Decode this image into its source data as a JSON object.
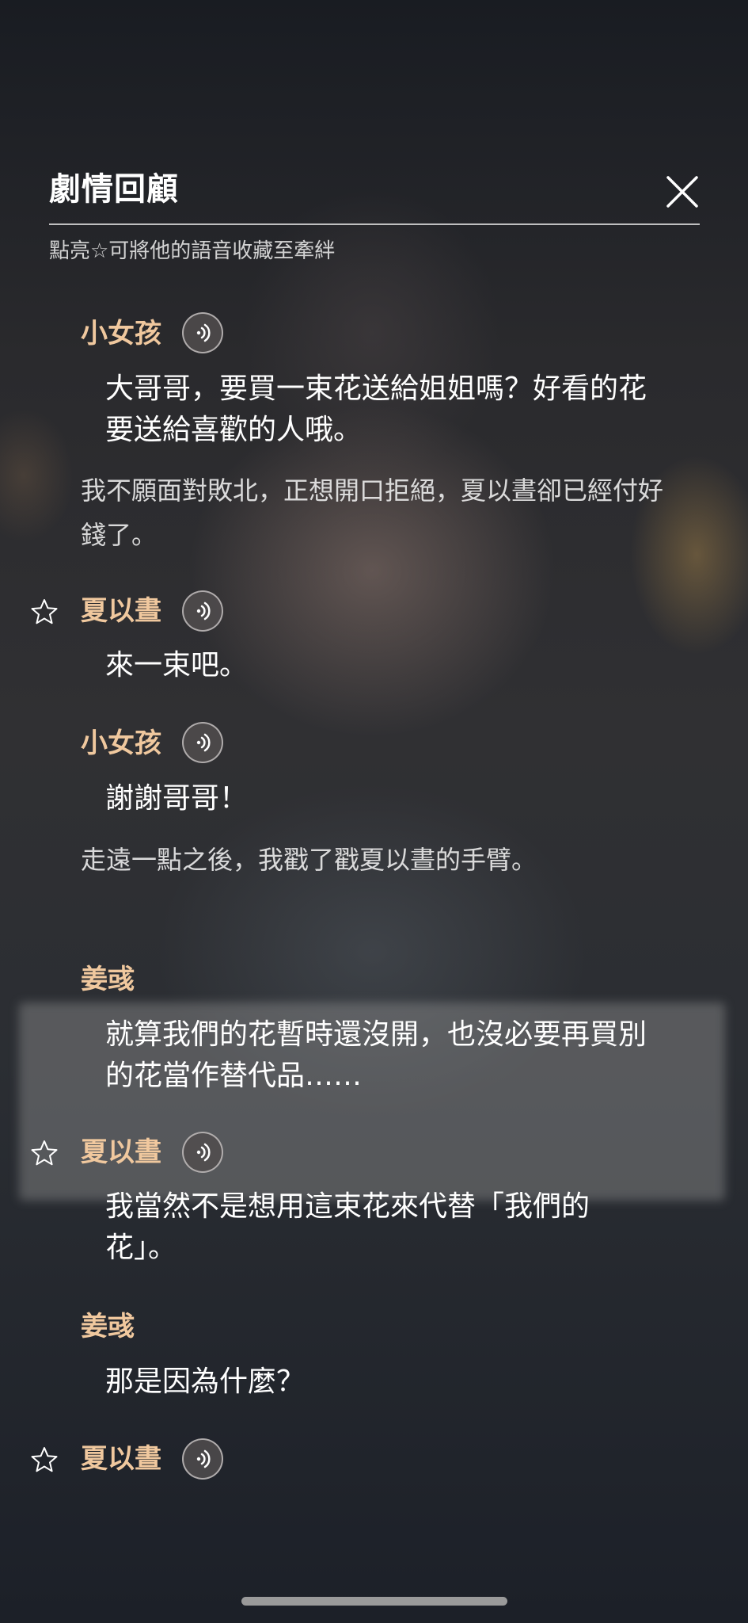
{
  "header": {
    "title": "劇情回顧",
    "subtitle": "點亮☆可將他的語音收藏至牽絆"
  },
  "dialogue": [
    {
      "speaker": "小女孩",
      "voice": true,
      "star": false,
      "line": "大哥哥，要買一束花送給姐姐嗎？好看的花要送給喜歡的人哦。"
    },
    {
      "narration": "我不願面對敗北，正想開口拒絕，夏以晝卻已經付好錢了。"
    },
    {
      "speaker": "夏以晝",
      "voice": true,
      "star": true,
      "line": "來一束吧。"
    },
    {
      "speaker": "小女孩",
      "voice": true,
      "star": false,
      "line": "謝謝哥哥！"
    },
    {
      "narration": "走遠一點之後，我戳了戳夏以晝的手臂。"
    },
    {
      "speaker": "姜彧",
      "voice": false,
      "star": false,
      "line": "就算我們的花暫時還沒開，也沒必要再買別的花當作替代品……"
    },
    {
      "speaker": "夏以晝",
      "voice": true,
      "star": true,
      "line": "我當然不是想用這束花來代替「我們的花」。"
    },
    {
      "speaker": "姜彧",
      "voice": false,
      "star": false,
      "line": "那是因為什麼？"
    },
    {
      "speaker": "夏以晝",
      "voice": true,
      "star": true,
      "line": ""
    }
  ],
  "icons": {
    "close": "close-icon",
    "voice": "voice-play-icon",
    "star": "star-outline-icon"
  },
  "colors": {
    "speaker": "#f0c89e",
    "text": "#ffffff"
  }
}
